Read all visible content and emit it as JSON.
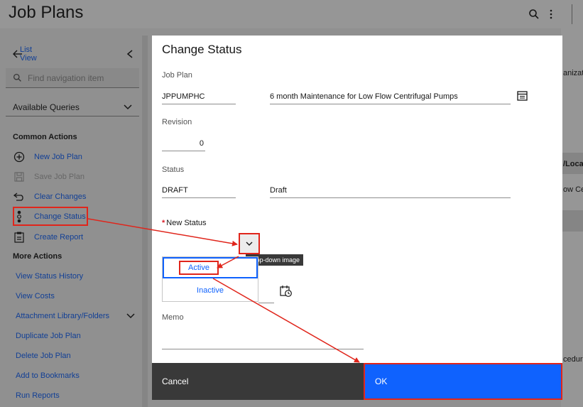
{
  "app": {
    "title": "Job Plans"
  },
  "sidebar": {
    "back_label": "List View",
    "search_placeholder": "Find navigation item",
    "queries_label": "Available Queries",
    "common_actions_heading": "Common Actions",
    "common_actions": [
      {
        "label": "New Job Plan",
        "icon": "plus-circle-icon",
        "enabled": true
      },
      {
        "label": "Save Job Plan",
        "icon": "save-icon",
        "enabled": false
      },
      {
        "label": "Clear Changes",
        "icon": "undo-icon",
        "enabled": true
      },
      {
        "label": "Change Status",
        "icon": "traffic-light-icon",
        "enabled": true
      },
      {
        "label": "Create Report",
        "icon": "report-icon",
        "enabled": true
      }
    ],
    "more_actions_heading": "More Actions",
    "more_actions": [
      "View Status History",
      "View Costs",
      "Attachment Library/Folders",
      "Duplicate Job Plan",
      "Delete Job Plan",
      "Add to Bookmarks",
      "Run Reports"
    ]
  },
  "background_peek": {
    "text1": "anizat",
    "text2": "/Locat",
    "text3": "ow Ce",
    "text4": "cedure"
  },
  "dialog": {
    "title": "Change Status",
    "job_plan_label": "Job Plan",
    "job_plan_value": "JPPUMPHC",
    "job_plan_description": "6 month Maintenance for Low Flow Centrifugal Pumps",
    "revision_label": "Revision",
    "revision_value": "0",
    "status_label": "Status",
    "status_value": "DRAFT",
    "status_description": "Draft",
    "new_status_required_mark": "*",
    "new_status_label": "New Status",
    "new_status_options": [
      "Active",
      "Inactive"
    ],
    "dropdown_tooltip": "Drop-down image",
    "memo_label": "Memo",
    "cancel_label": "Cancel",
    "ok_label": "OK"
  },
  "colors": {
    "accent": "#0f62fe",
    "annotation": "#e0251b",
    "cancel_bg": "#393939"
  }
}
